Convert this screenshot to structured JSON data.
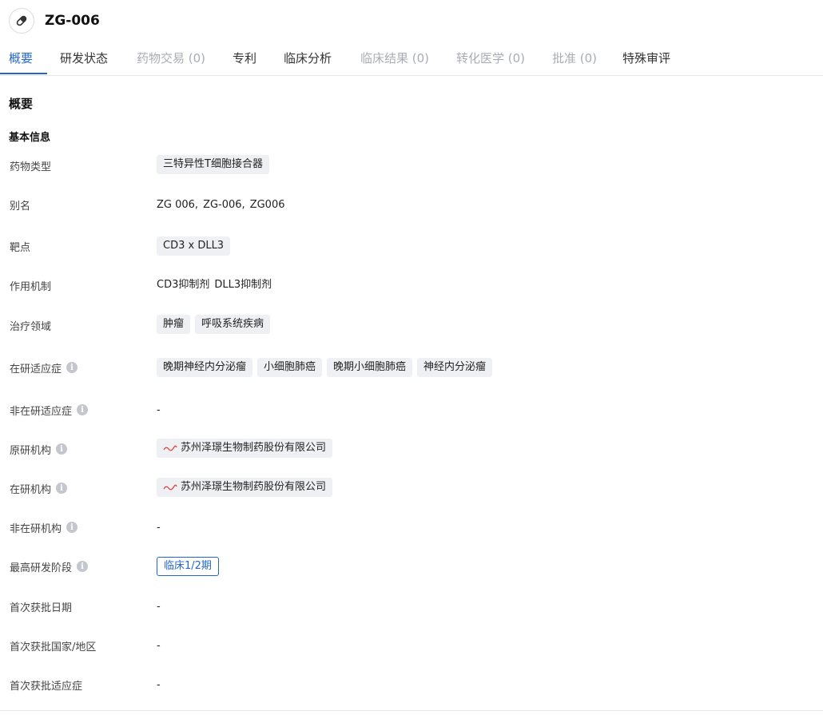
{
  "header": {
    "title": "ZG-006",
    "icon": "pill-icon"
  },
  "tabs": [
    {
      "label": "概要",
      "state": "active"
    },
    {
      "label": "研发状态",
      "state": "normal"
    },
    {
      "label": "药物交易 (0)",
      "state": "disabled"
    },
    {
      "label": "专利",
      "state": "normal"
    },
    {
      "label": "临床分析",
      "state": "normal"
    },
    {
      "label": "临床结果 (0)",
      "state": "disabled"
    },
    {
      "label": "转化医学 (0)",
      "state": "disabled"
    },
    {
      "label": "批准 (0)",
      "state": "disabled"
    },
    {
      "label": "特殊审评",
      "state": "normal"
    }
  ],
  "section": {
    "title": "概要",
    "group": "基本信息"
  },
  "fields": {
    "drug_type": {
      "label": "药物类型",
      "tags": [
        "三特异性T细胞接合器"
      ]
    },
    "alias": {
      "label": "别名",
      "values": [
        "ZG 006,",
        "ZG-006,",
        "ZG006"
      ]
    },
    "target": {
      "label": "靶点",
      "tags": [
        "CD3 x DLL3"
      ]
    },
    "mechanism": {
      "label": "作用机制",
      "values": [
        "CD3抑制剂",
        "DLL3抑制剂"
      ]
    },
    "therapeutic_area": {
      "label": "治疗领域",
      "tags": [
        "肿瘤",
        "呼吸系统疾病"
      ]
    },
    "active_indication": {
      "label": "在研适应症",
      "tags": [
        "晚期神经内分泌瘤",
        "小细胞肺癌",
        "晚期小细胞肺癌",
        "神经内分泌瘤"
      ]
    },
    "inactive_indication": {
      "label": "非在研适应症",
      "value": "-"
    },
    "originator": {
      "label": "原研机构",
      "org": "苏州泽璟生物制药股份有限公司"
    },
    "active_org": {
      "label": "在研机构",
      "org": "苏州泽璟生物制药股份有限公司"
    },
    "inactive_org": {
      "label": "非在研机构",
      "value": "-"
    },
    "highest_phase": {
      "label": "最高研发阶段",
      "value": "临床1/2期"
    },
    "first_approval_date": {
      "label": "首次获批日期",
      "value": "-"
    },
    "first_approval_country": {
      "label": "首次获批国家/地区",
      "value": "-"
    },
    "first_approval_indication": {
      "label": "首次获批适应症",
      "value": "-"
    }
  },
  "info_icon_glyph": "i",
  "colors": {
    "accent": "#2567c7",
    "tag_bg": "#eef0f3",
    "disabled": "#a9adb3"
  }
}
